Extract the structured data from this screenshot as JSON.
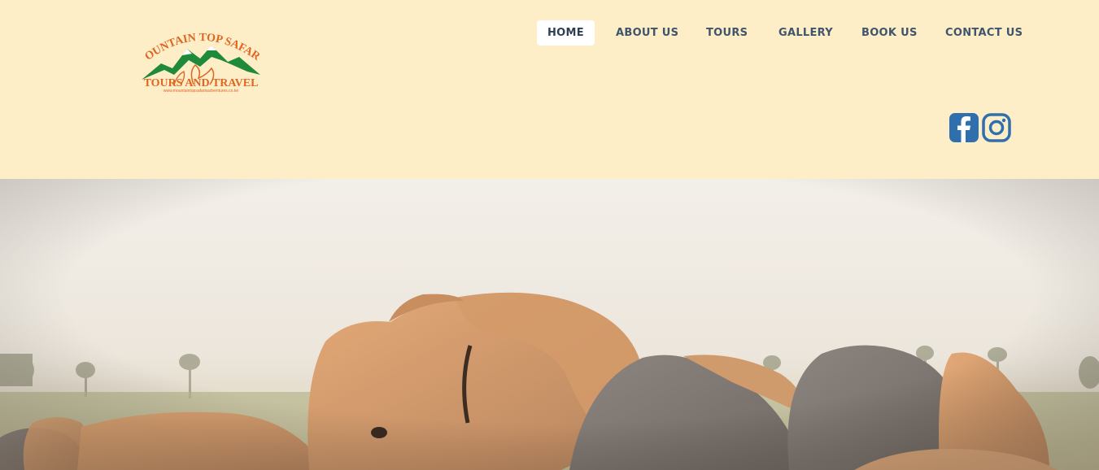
{
  "logo": {
    "line1": "MOUNTAIN TOP SAFARIS",
    "line2": "TOURS AND TRAVEL",
    "url": "www.mountaintopsafarisadventures.co.ke"
  },
  "nav": {
    "items": [
      {
        "label": "HOME",
        "active": true
      },
      {
        "label": "ABOUT US",
        "active": false
      },
      {
        "label": "TOURS",
        "active": false
      },
      {
        "label": "GALLERY",
        "active": false
      },
      {
        "label": "BOOK US",
        "active": false
      },
      {
        "label": "CONTACT US",
        "active": false
      }
    ]
  },
  "social": {
    "facebook_icon": "facebook-icon",
    "instagram_icon": "instagram-icon",
    "color": "#2f6fae"
  },
  "hero": {
    "image_subject": "elephants"
  },
  "colors": {
    "header_bg": "#fdeec8",
    "nav_text": "#40556b",
    "logo_orange": "#e0651f",
    "logo_green": "#1f8a3a"
  }
}
